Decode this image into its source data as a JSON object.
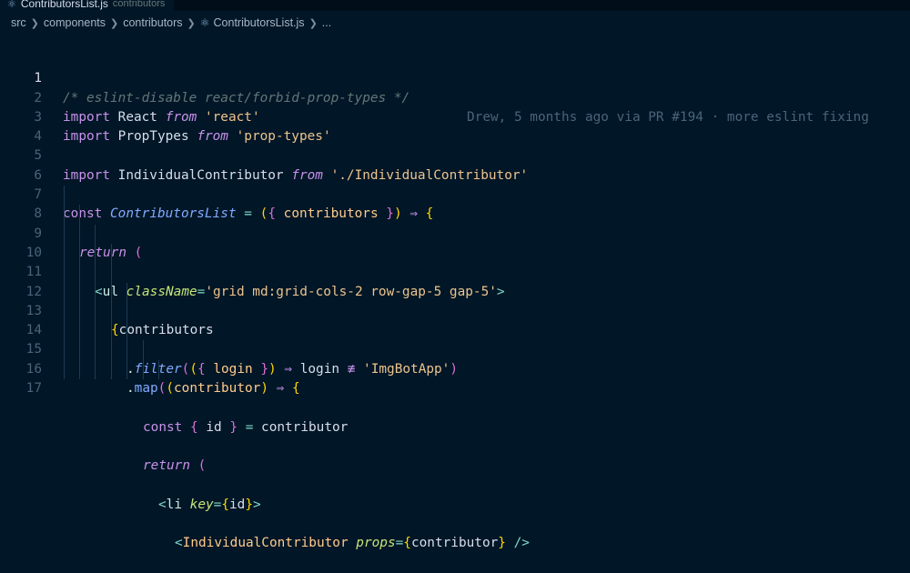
{
  "tab": {
    "filename": "ContributorsList.js",
    "description": "contributors"
  },
  "breadcrumb": [
    "src",
    "components",
    "contributors",
    "ContributorsList.js",
    "..."
  ],
  "blame": "Drew, 5 months ago via PR #194 · more eslint fixing",
  "code": {
    "l1": "/* eslint-disable react/forbid-prop-types */",
    "l2_kw": "import",
    "l2_id": "React",
    "l2_from": "from",
    "l2_str": "'react'",
    "l3_kw": "import",
    "l3_id": "PropTypes",
    "l3_from": "from",
    "l3_str": "'prop-types'",
    "l5_kw": "import",
    "l5_id": "IndividualContributor",
    "l5_from": "from",
    "l5_str": "'./IndividualContributor'",
    "l7_const": "const",
    "l7_name": "ContributorsList",
    "l7_eq": "=",
    "l7_open": "(",
    "l7_brace_open": "{",
    "l7_param": "contributors",
    "l7_brace_close": "}",
    "l7_close": ")",
    "l7_arrow": "⇒",
    "l7_body": "{",
    "l8_return": "return",
    "l8_paren": "(",
    "l9_lt": "<",
    "l9_tag": "ul",
    "l9_attr": "className",
    "l9_eq": "=",
    "l9_val": "'grid md:grid-cols-2 row-gap-5 gap-5'",
    "l9_gt": ">",
    "l10_brace": "{",
    "l10_id": "contributors",
    "l11_dot": ".",
    "l11_fn": "filter",
    "l11_p1": "(",
    "l11_p2": "(",
    "l11_b1": "{",
    "l11_arg": "login",
    "l11_b2": "}",
    "l11_p3": ")",
    "l11_arrow": "⇒",
    "l11_id": "login",
    "l11_neq": "≢",
    "l11_str": "'ImgBotApp'",
    "l11_p4": ")",
    "l12_dot": ".",
    "l12_fn": "map",
    "l12_p1": "(",
    "l12_p2": "(",
    "l12_arg": "contributor",
    "l12_p3": ")",
    "l12_arrow": "⇒",
    "l12_body": "{",
    "l13_const": "const",
    "l13_b1": "{",
    "l13_id": "id",
    "l13_b2": "}",
    "l13_eq": "=",
    "l13_val": "contributor",
    "l15_return": "return",
    "l15_paren": "(",
    "l16_lt": "<",
    "l16_tag": "li",
    "l16_attr": "key",
    "l16_eq": "=",
    "l16_b1": "{",
    "l16_val": "id",
    "l16_b2": "}",
    "l16_gt": ">",
    "l17_lt": "<",
    "l17_tag": "IndividualContributor",
    "l17_attr": "props",
    "l17_eq": "=",
    "l17_b1": "{",
    "l17_val": "contributor",
    "l17_b2": "}",
    "l17_close": "/>"
  },
  "line_numbers": [
    "1",
    "2",
    "3",
    "4",
    "5",
    "6",
    "7",
    "8",
    "9",
    "10",
    "11",
    "12",
    "13",
    "14",
    "15",
    "16",
    "17"
  ],
  "colors": {
    "background": "#011627",
    "keyword": "#c792ea",
    "string": "#ecc48d",
    "function": "#82aaff",
    "operator": "#7fdbca",
    "comment": "#637777"
  }
}
